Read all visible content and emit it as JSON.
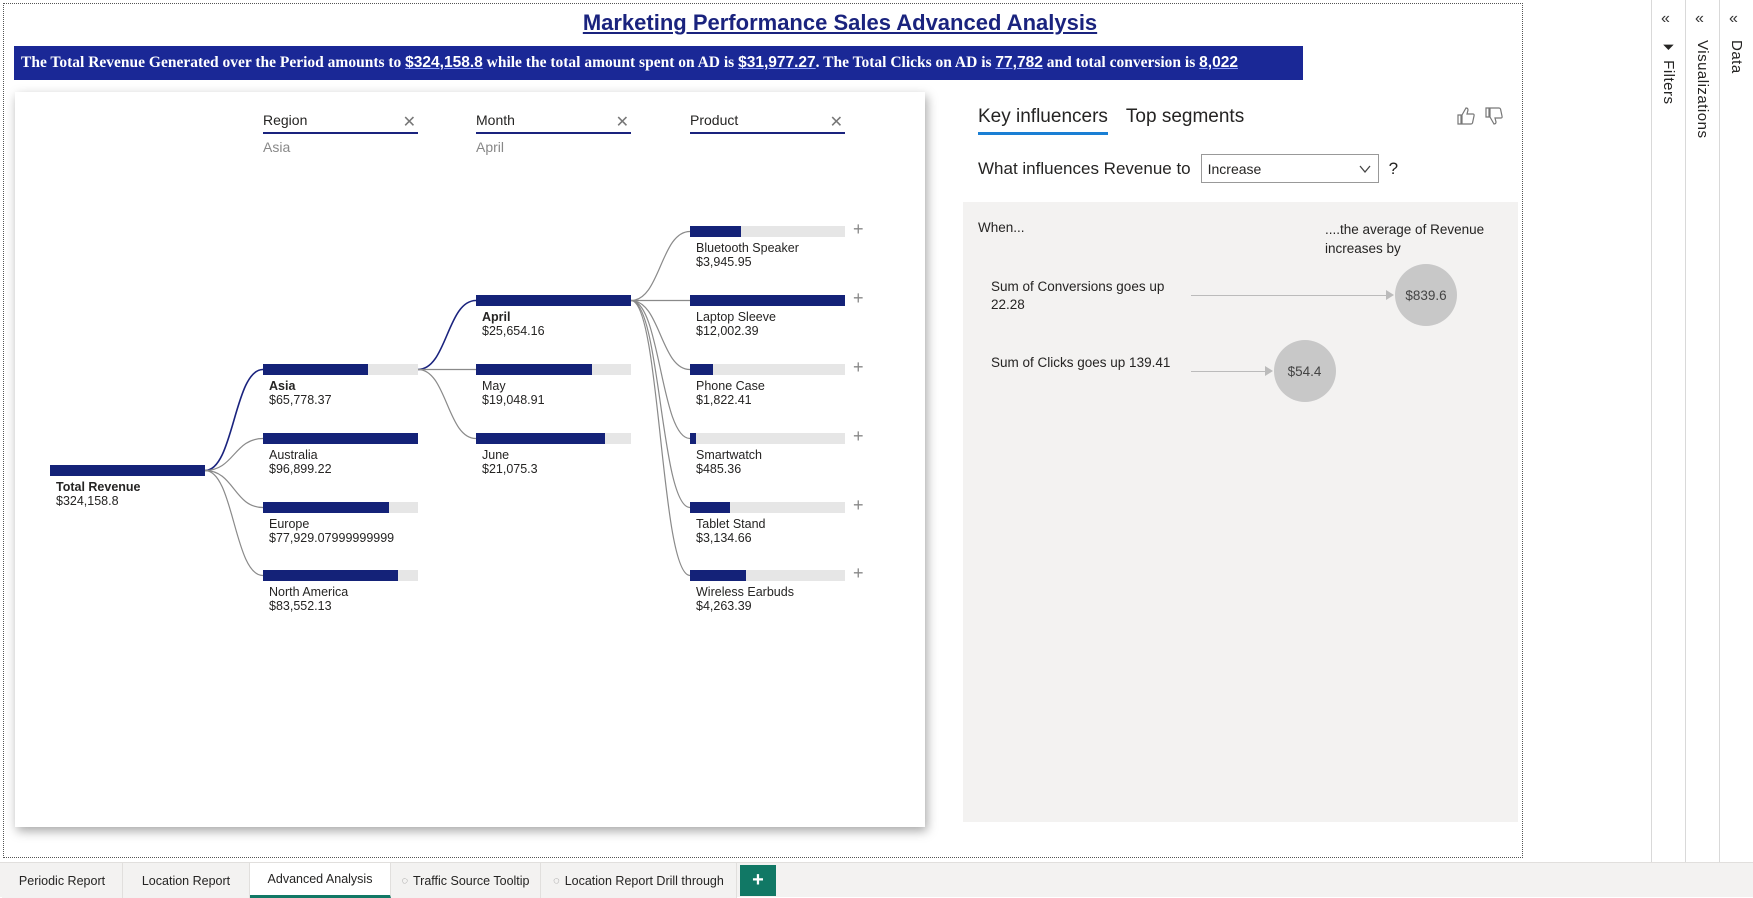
{
  "report_title": "Marketing Performance Sales Advanced Analysis",
  "banner": {
    "t1": "The Total Revenue Generated over the Period amounts to ",
    "v1": "$324,158.8",
    "t2": " while the total amount spent on AD is ",
    "v2": "$31,977.27",
    "t3": ". The Total Clicks on AD is ",
    "v3": "77,782",
    "t4": " and total conversion is ",
    "v4": "8,022"
  },
  "decomposition_tree": {
    "root": {
      "name": "Total Revenue",
      "value": "$324,158.8",
      "fill": 1.0
    },
    "levels": [
      {
        "header": "Region",
        "selection": "Asia"
      },
      {
        "header": "Month",
        "selection": "April"
      },
      {
        "header": "Product",
        "selection": ""
      }
    ],
    "regions": [
      {
        "name": "Asia",
        "value": "$65,778.37",
        "fill": 0.68,
        "selected": true
      },
      {
        "name": "Australia",
        "value": "$96,899.22",
        "fill": 1.0,
        "selected": false
      },
      {
        "name": "Europe",
        "value": "$77,929.07999999999",
        "fill": 0.81,
        "selected": false
      },
      {
        "name": "North America",
        "value": "$83,552.13",
        "fill": 0.87,
        "selected": false
      }
    ],
    "months": [
      {
        "name": "April",
        "value": "$25,654.16",
        "fill": 1.0,
        "selected": true
      },
      {
        "name": "May",
        "value": "$19,048.91",
        "fill": 0.75,
        "selected": false
      },
      {
        "name": "June",
        "value": "$21,075.3",
        "fill": 0.83,
        "selected": false
      }
    ],
    "products": [
      {
        "name": "Bluetooth Speaker",
        "value": "$3,945.95",
        "fill": 0.33
      },
      {
        "name": "Laptop Sleeve",
        "value": "$12,002.39",
        "fill": 1.0
      },
      {
        "name": "Phone Case",
        "value": "$1,822.41",
        "fill": 0.15
      },
      {
        "name": "Smartwatch",
        "value": "$485.36",
        "fill": 0.04
      },
      {
        "name": "Tablet Stand",
        "value": "$3,134.66",
        "fill": 0.26
      },
      {
        "name": "Wireless Earbuds",
        "value": "$4,263.39",
        "fill": 0.36
      }
    ],
    "plus_symbol": "+",
    "close_symbol": "✕"
  },
  "key_influencers": {
    "tabs": [
      "Key influencers",
      "Top segments"
    ],
    "question_prefix": "What influences Revenue to",
    "dropdown_value": "Increase",
    "question_mark": "?",
    "col_when": "When...",
    "col_avg": "....the average of Revenue increases by",
    "influencers": [
      {
        "text": "Sum of Conversions goes up 22.28",
        "value": "$839.6",
        "strength": 1.0
      },
      {
        "text": "Sum of Clicks goes up 139.41",
        "value": "$54.4",
        "strength": 0.25
      }
    ]
  },
  "side_panes": [
    "Filters",
    "Visualizations",
    "Data"
  ],
  "page_tabs": [
    {
      "label": "Periodic Report",
      "hidden": false,
      "active": false
    },
    {
      "label": "Location Report",
      "hidden": false,
      "active": false
    },
    {
      "label": "Advanced Analysis",
      "hidden": false,
      "active": true
    },
    {
      "label": "Traffic Source Tooltip",
      "hidden": true,
      "active": false
    },
    {
      "label": "Location Report Drill through",
      "hidden": true,
      "active": false
    }
  ],
  "add_page_label": "+",
  "colors": {
    "accent": "#1a237e",
    "bar": "#142278",
    "banner": "#1a2896",
    "page_tab_accent": "#117865"
  }
}
